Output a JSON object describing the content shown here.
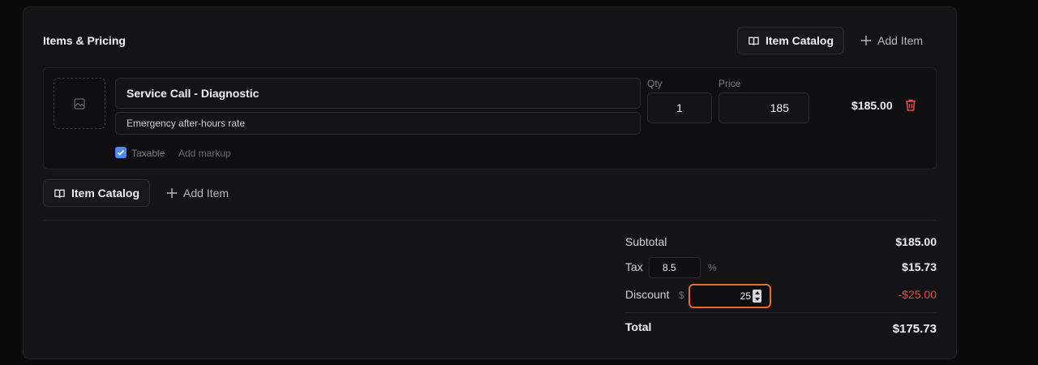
{
  "section": {
    "title": "Items & Pricing"
  },
  "header_actions": {
    "catalog_label": "Item Catalog",
    "add_label": "Add Item"
  },
  "item": {
    "name": "Service Call - Diagnostic",
    "description": "Emergency after-hours rate",
    "qty_label": "Qty",
    "qty": "1",
    "price_label": "Price",
    "price": "185",
    "line_total": "$185.00",
    "taxable_label": "Taxable",
    "taxable": true,
    "markup_label": "Add markup"
  },
  "footer_actions": {
    "catalog_label": "Item Catalog",
    "add_label": "Add Item"
  },
  "summary": {
    "subtotal_label": "Subtotal",
    "subtotal": "$185.00",
    "tax_label": "Tax",
    "tax_rate": "8.5",
    "tax_unit": "%",
    "tax_amount": "$15.73",
    "discount_label": "Discount",
    "discount_unit": "$",
    "discount_value": "25",
    "discount_amount": "-$25.00",
    "total_label": "Total",
    "total": "$175.73"
  },
  "colors": {
    "accent_focus": "#e8692d",
    "danger": "#e5484d",
    "checkbox": "#4c8bf5"
  }
}
